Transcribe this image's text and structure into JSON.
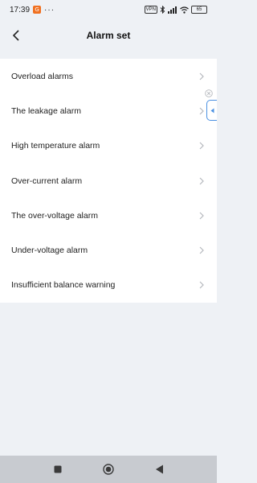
{
  "status_bar": {
    "time": "17:39",
    "app_badge": "G",
    "dots": "···",
    "vpn_label": "VPN",
    "battery": "65",
    "icons": [
      "vpn-icon",
      "bluetooth-icon",
      "signal-icon",
      "wifi-icon",
      "battery-icon"
    ]
  },
  "header": {
    "title": "Alarm set",
    "back_icon": "chevron-left-icon"
  },
  "alarms": [
    {
      "label": "Overload alarms"
    },
    {
      "label": "The leakage alarm"
    },
    {
      "label": "High temperature alarm"
    },
    {
      "label": "Over-current alarm"
    },
    {
      "label": "The over-voltage alarm"
    },
    {
      "label": "Under-voltage alarm"
    },
    {
      "label": "Insufficient balance warning"
    }
  ],
  "floating_tab": {
    "icon": "caret-left-icon",
    "close_icon": "close-circle-icon",
    "accent": "#4a90e2"
  },
  "nav_bar": {
    "icons": [
      "square-icon",
      "circle-home-icon",
      "triangle-back-icon"
    ]
  }
}
